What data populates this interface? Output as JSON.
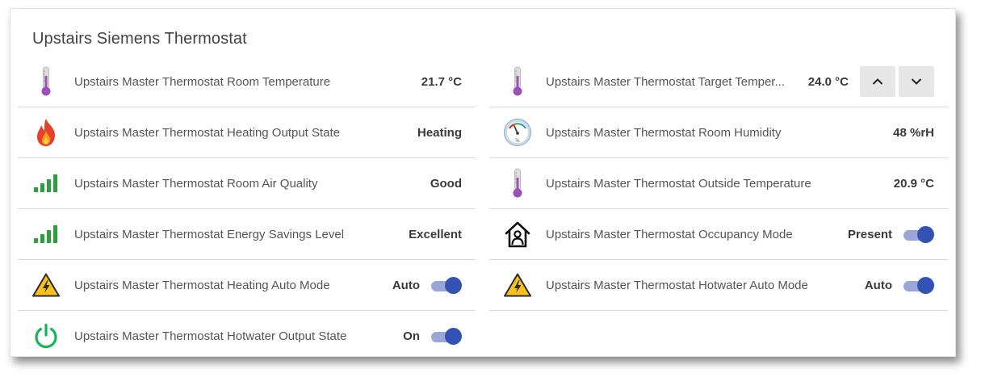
{
  "card": {
    "title": "Upstairs Siemens Thermostat"
  },
  "left_rows": [
    {
      "icon": "thermometer-icon",
      "label": "Upstairs Master Thermostat Room Temperature",
      "value": "21.7 °C"
    },
    {
      "icon": "flame-icon",
      "label": "Upstairs Master Thermostat Heating Output State",
      "value": "Heating"
    },
    {
      "icon": "signal-bars-icon",
      "label": "Upstairs Master Thermostat Room Air Quality",
      "value": "Good"
    },
    {
      "icon": "signal-bars-icon",
      "label": "Upstairs Master Thermostat Energy Savings Level",
      "value": "Excellent"
    },
    {
      "icon": "high-voltage-icon",
      "label": "Upstairs Master Thermostat Heating Auto Mode",
      "value": "Auto",
      "toggle": true
    },
    {
      "icon": "power-icon",
      "label": "Upstairs Master Thermostat Hotwater Output State",
      "value": "On",
      "toggle": true
    }
  ],
  "right_rows": [
    {
      "icon": "thermometer-icon",
      "label": "Upstairs Master Thermostat Target Temper...",
      "value": "24.0 °C",
      "stepper": true
    },
    {
      "icon": "hygrometer-icon",
      "label": "Upstairs Master Thermostat Room Humidity",
      "value": "48 %rH"
    },
    {
      "icon": "thermometer-icon",
      "label": "Upstairs Master Thermostat Outside Temperature",
      "value": "20.9 °C"
    },
    {
      "icon": "house-person-icon",
      "label": "Upstairs Master Thermostat Occupancy Mode",
      "value": "Present",
      "toggle": true
    },
    {
      "icon": "high-voltage-icon",
      "label": "Upstairs Master Thermostat Hotwater Auto Mode",
      "value": "Auto",
      "toggle": true
    }
  ],
  "colors": {
    "toggle_knob": "#3452b4",
    "toggle_track": "#9aa6d8",
    "signal_green": "#2e9e3e",
    "power_green": "#16b55a",
    "thermometer_purple": "#9c4fb8"
  }
}
